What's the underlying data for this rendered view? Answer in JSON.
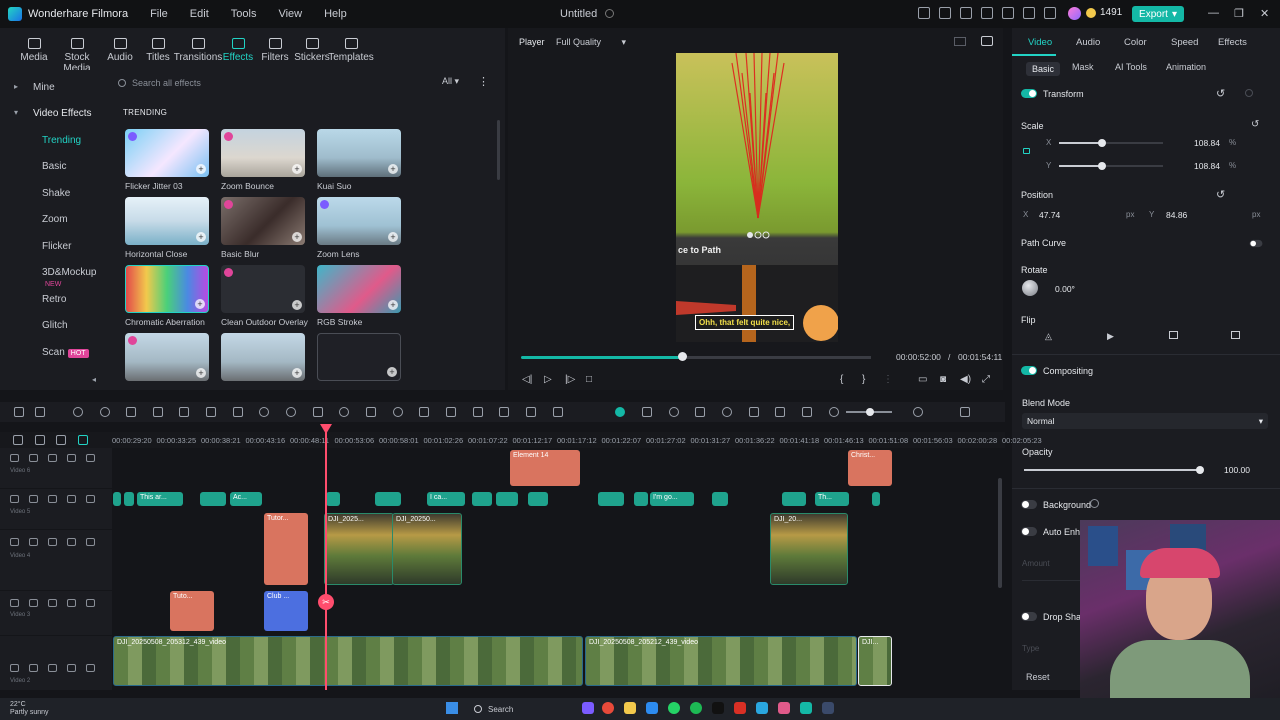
{
  "app": {
    "name": "Wonderhare Filmora",
    "menus": [
      "File",
      "Edit",
      "Tools",
      "View",
      "Help"
    ],
    "project_title": "Untitled",
    "credits": "1491",
    "export_label": "Export",
    "window_controls": [
      "—",
      "❐",
      "✕"
    ]
  },
  "media_tabs": [
    {
      "label": "Media",
      "icon": "media-icon"
    },
    {
      "label": "Stock Media",
      "icon": "stock-media-icon"
    },
    {
      "label": "Audio",
      "icon": "audio-icon"
    },
    {
      "label": "Titles",
      "icon": "titles-icon"
    },
    {
      "label": "Transitions",
      "icon": "transitions-icon"
    },
    {
      "label": "Effects",
      "icon": "effects-icon",
      "active": true
    },
    {
      "label": "Filters",
      "icon": "filters-icon"
    },
    {
      "label": "Stickers",
      "icon": "stickers-icon"
    },
    {
      "label": "Templates",
      "icon": "templates-icon"
    }
  ],
  "left_nav": {
    "mine": "Mine",
    "video_effects": "Video Effects",
    "items": [
      {
        "label": "Trending",
        "active": true
      },
      {
        "label": "Basic"
      },
      {
        "label": "Shake"
      },
      {
        "label": "Zoom"
      },
      {
        "label": "Flicker"
      },
      {
        "label": "3D&Mockup",
        "badge": "NEW"
      },
      {
        "label": "Retro"
      },
      {
        "label": "Glitch"
      },
      {
        "label": "Scan",
        "badge": "HOT"
      }
    ]
  },
  "effects": {
    "search_placeholder": "Search all effects",
    "filter_value": "All",
    "section_title": "TRENDING",
    "items": [
      {
        "label": "Flicker Jitter 03"
      },
      {
        "label": "Zoom Bounce"
      },
      {
        "label": "Kuai Suo"
      },
      {
        "label": "Horizontal Close"
      },
      {
        "label": "Basic Blur"
      },
      {
        "label": "Zoom Lens"
      },
      {
        "label": "Chromatic Aberration"
      },
      {
        "label": "Clean Outdoor Overlay"
      },
      {
        "label": "RGB Stroke"
      }
    ]
  },
  "player": {
    "tab": "Player",
    "quality": "Full Quality",
    "caption": "Ohh, that felt quite nice,",
    "video_text": "ce to Path",
    "current_time": "00:00:52:00",
    "separator": "/",
    "total_time": "00:01:54:11",
    "progress": 0.46
  },
  "right_panel": {
    "tabs": [
      "Video",
      "Audio",
      "Color",
      "Speed",
      "Effects"
    ],
    "subtabs": [
      "Basic",
      "Mask",
      "AI Tools",
      "Animation"
    ],
    "transform": "Transform",
    "scale": "Scale",
    "scale_x_label": "X",
    "scale_y_label": "Y",
    "scale_x": "108.84",
    "scale_y": "108.84",
    "scale_unit": "%",
    "scale_fraction": 0.11,
    "position": "Position",
    "pos_x_label": "X",
    "pos_x": "47.74",
    "pos_y_label": "Y",
    "pos_y": "84.86",
    "pos_unit": "px",
    "path_curve": "Path Curve",
    "rotate": "Rotate",
    "rotate_value": "0.00°",
    "flip": "Flip",
    "compositing": "Compositing",
    "blend_mode": "Blend Mode",
    "blend_value": "Normal",
    "opacity": "Opacity",
    "opacity_value": "100.00",
    "background": "Background",
    "auto_enhance": "Auto Enha",
    "amount": "Amount",
    "drop_shadow": "Drop Shad",
    "type": "Type",
    "reset": "Reset"
  },
  "timeline": {
    "ruler": [
      "00:00:29:20",
      "00:00:33:25",
      "00:00:38:21",
      "00:00:43:16",
      "00:00:48:11",
      "00:00:53:06",
      "00:00:58:01",
      "00:01:02:26",
      "00:01:07:22",
      "00:01:12:17",
      "00:01:17:12",
      "00:01:22:07",
      "00:01:27:02",
      "00:01:31:27",
      "00:01:36:22",
      "00:01:41:18",
      "00:01:46:13",
      "00:01:51:08",
      "00:01:56:03",
      "00:02:00:28",
      "00:02:05:23"
    ],
    "tracks": [
      "Video 6",
      "Video 5",
      "Video 4",
      "Video 3",
      "Video 2"
    ],
    "clips": {
      "element14": "Element 14",
      "christ": "Christ...",
      "this_ar": "This ar...",
      "ac": "Ac...",
      "i_ca": "I ca...",
      "im_go": "I'm go...",
      "th": "Th...",
      "tutor": "Tutor...",
      "dji1": "DJI_2025...",
      "dji2": "DJI_20250...",
      "dji3": "DJI_20...",
      "tuto": "Tuto...",
      "club": "Club ...",
      "main1": "DJI_20250508_205312_439_video",
      "main2": "DJI_20250508_205212_439_video",
      "main3": "DJI..."
    }
  },
  "taskbar": {
    "temperature": "22°C",
    "weather": "Partly sunny",
    "search": "Search"
  },
  "colors": {
    "accent": "#22d3c5",
    "export": "#14b8a6",
    "playhead": "#ff4d6d"
  }
}
